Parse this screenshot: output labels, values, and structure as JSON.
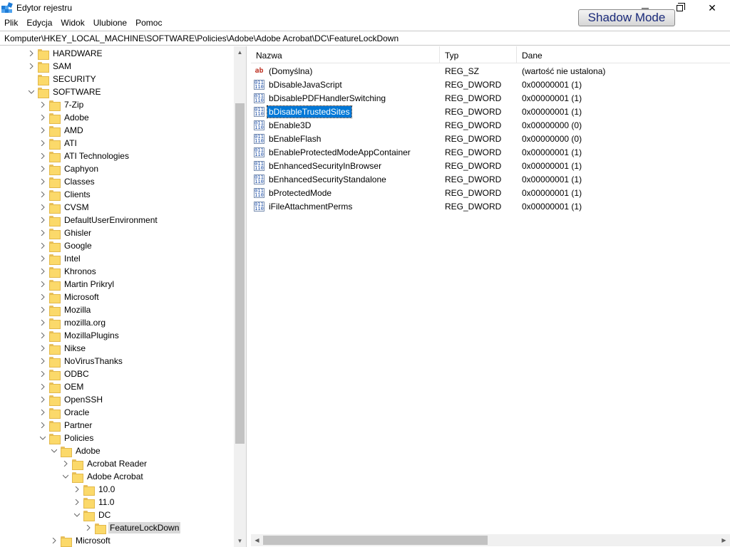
{
  "window": {
    "title": "Edytor rejestru",
    "app_icon": "regedit-icon",
    "minimize": "─",
    "close": "✕"
  },
  "overlay": {
    "shadow_mode_label": "Shadow Mode"
  },
  "menu": [
    {
      "label": "Plik"
    },
    {
      "label": "Edycja"
    },
    {
      "label": "Widok"
    },
    {
      "label": "Ulubione"
    },
    {
      "label": "Pomoc"
    }
  ],
  "address": "Komputer\\HKEY_LOCAL_MACHINE\\SOFTWARE\\Policies\\Adobe\\Adobe Acrobat\\DC\\FeatureLockDown",
  "tree": [
    {
      "label": "HARDWARE",
      "depth": 0,
      "state": "collapsed"
    },
    {
      "label": "SAM",
      "depth": 0,
      "state": "collapsed"
    },
    {
      "label": "SECURITY",
      "depth": 0,
      "state": "none"
    },
    {
      "label": "SOFTWARE",
      "depth": 0,
      "state": "expanded"
    },
    {
      "label": "7-Zip",
      "depth": 1,
      "state": "collapsed"
    },
    {
      "label": "Adobe",
      "depth": 1,
      "state": "collapsed"
    },
    {
      "label": "AMD",
      "depth": 1,
      "state": "collapsed"
    },
    {
      "label": "ATI",
      "depth": 1,
      "state": "collapsed"
    },
    {
      "label": "ATI Technologies",
      "depth": 1,
      "state": "collapsed"
    },
    {
      "label": "Caphyon",
      "depth": 1,
      "state": "collapsed"
    },
    {
      "label": "Classes",
      "depth": 1,
      "state": "collapsed"
    },
    {
      "label": "Clients",
      "depth": 1,
      "state": "collapsed"
    },
    {
      "label": "CVSM",
      "depth": 1,
      "state": "collapsed"
    },
    {
      "label": "DefaultUserEnvironment",
      "depth": 1,
      "state": "collapsed"
    },
    {
      "label": "Ghisler",
      "depth": 1,
      "state": "collapsed"
    },
    {
      "label": "Google",
      "depth": 1,
      "state": "collapsed"
    },
    {
      "label": "Intel",
      "depth": 1,
      "state": "collapsed"
    },
    {
      "label": "Khronos",
      "depth": 1,
      "state": "collapsed"
    },
    {
      "label": "Martin Prikryl",
      "depth": 1,
      "state": "collapsed"
    },
    {
      "label": "Microsoft",
      "depth": 1,
      "state": "collapsed"
    },
    {
      "label": "Mozilla",
      "depth": 1,
      "state": "collapsed"
    },
    {
      "label": "mozilla.org",
      "depth": 1,
      "state": "collapsed"
    },
    {
      "label": "MozillaPlugins",
      "depth": 1,
      "state": "collapsed"
    },
    {
      "label": "Nikse",
      "depth": 1,
      "state": "collapsed"
    },
    {
      "label": "NoVirusThanks",
      "depth": 1,
      "state": "collapsed"
    },
    {
      "label": "ODBC",
      "depth": 1,
      "state": "collapsed"
    },
    {
      "label": "OEM",
      "depth": 1,
      "state": "collapsed"
    },
    {
      "label": "OpenSSH",
      "depth": 1,
      "state": "collapsed"
    },
    {
      "label": "Oracle",
      "depth": 1,
      "state": "collapsed"
    },
    {
      "label": "Partner",
      "depth": 1,
      "state": "collapsed"
    },
    {
      "label": "Policies",
      "depth": 1,
      "state": "expanded"
    },
    {
      "label": "Adobe",
      "depth": 2,
      "state": "expanded"
    },
    {
      "label": "Acrobat Reader",
      "depth": 3,
      "state": "collapsed"
    },
    {
      "label": "Adobe Acrobat",
      "depth": 3,
      "state": "expanded"
    },
    {
      "label": "10.0",
      "depth": 4,
      "state": "collapsed"
    },
    {
      "label": "11.0",
      "depth": 4,
      "state": "collapsed"
    },
    {
      "label": "DC",
      "depth": 4,
      "state": "expanded"
    },
    {
      "label": "FeatureLockDown",
      "depth": 5,
      "state": "collapsed",
      "selected": true
    },
    {
      "label": "Microsoft",
      "depth": 2,
      "state": "collapsed"
    }
  ],
  "columns": {
    "name": "Nazwa",
    "type": "Typ",
    "data": "Dane"
  },
  "values": [
    {
      "name": "(Domyślna)",
      "type": "REG_SZ",
      "data": "(wartość nie ustalona)",
      "icon": "string-value-icon"
    },
    {
      "name": "bDisableJavaScript",
      "type": "REG_DWORD",
      "data": "0x00000001 (1)",
      "icon": "binary-value-icon"
    },
    {
      "name": "bDisablePDFHandlerSwitching",
      "type": "REG_DWORD",
      "data": "0x00000001 (1)",
      "icon": "binary-value-icon"
    },
    {
      "name": "bDisableTrustedSites",
      "type": "REG_DWORD",
      "data": "0x00000001 (1)",
      "icon": "binary-value-icon",
      "selected": true
    },
    {
      "name": "bEnable3D",
      "type": "REG_DWORD",
      "data": "0x00000000 (0)",
      "icon": "binary-value-icon"
    },
    {
      "name": "bEnableFlash",
      "type": "REG_DWORD",
      "data": "0x00000000 (0)",
      "icon": "binary-value-icon"
    },
    {
      "name": "bEnableProtectedModeAppContainer",
      "type": "REG_DWORD",
      "data": "0x00000001 (1)",
      "icon": "binary-value-icon"
    },
    {
      "name": "bEnhancedSecurityInBrowser",
      "type": "REG_DWORD",
      "data": "0x00000001 (1)",
      "icon": "binary-value-icon"
    },
    {
      "name": "bEnhancedSecurityStandalone",
      "type": "REG_DWORD",
      "data": "0x00000001 (1)",
      "icon": "binary-value-icon"
    },
    {
      "name": "bProtectedMode",
      "type": "REG_DWORD",
      "data": "0x00000001 (1)",
      "icon": "binary-value-icon"
    },
    {
      "name": "iFileAttachmentPerms",
      "type": "REG_DWORD",
      "data": "0x00000001 (1)",
      "icon": "binary-value-icon"
    }
  ],
  "colors": {
    "selection": "#0078d7",
    "tree_selection": "#d9d9d9",
    "folder": "#fbd96a"
  }
}
